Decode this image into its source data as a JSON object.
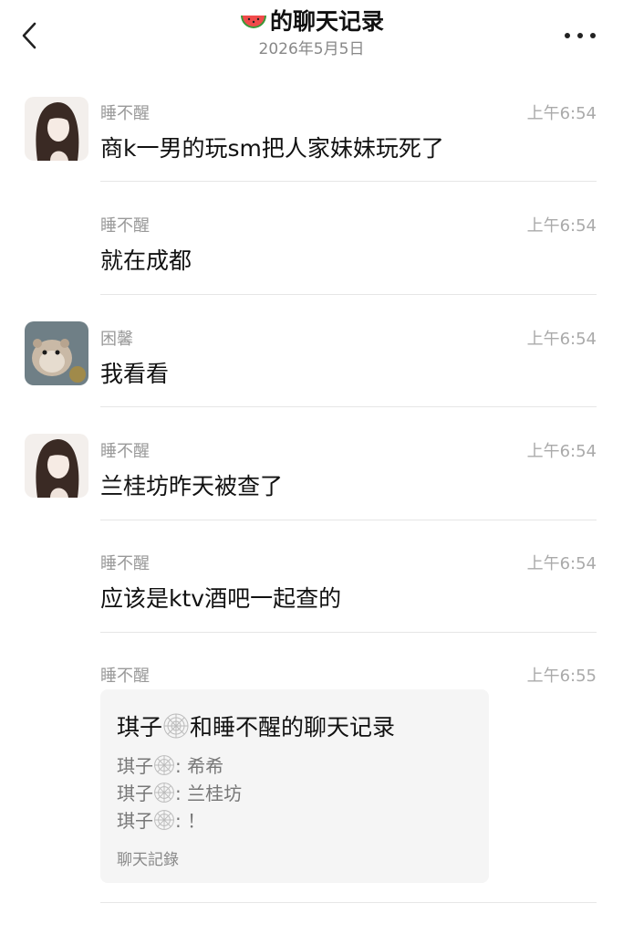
{
  "header": {
    "title_icon": "watermelon-emoji",
    "title": "的聊天记录",
    "date": "2026年5月5日",
    "back_icon": "chevron-left-icon",
    "more_icon": "more-dots-icon"
  },
  "messages": [
    {
      "sender": "睡不醒",
      "time": "上午6:54",
      "text": "商k一男的玩sm把人家妹妹玩死了",
      "avatar": "girl-avatar"
    },
    {
      "sender": "睡不醒",
      "time": "上午6:54",
      "text": "就在成都"
    },
    {
      "sender": "困馨",
      "time": "上午6:54",
      "text": "我看看",
      "avatar": "hamster-avatar"
    },
    {
      "sender": "睡不醒",
      "time": "上午6:54",
      "text": "兰桂坊昨天被查了",
      "avatar": "girl-avatar"
    },
    {
      "sender": "睡不醒",
      "time": "上午6:54",
      "text": "应该是ktv酒吧一起查的"
    },
    {
      "sender": "睡不醒",
      "time": "上午6:55"
    }
  ],
  "card": {
    "title_a": "琪子",
    "title_icon": "spider-web-emoji",
    "title_b": "和睡不醒的聊天记录",
    "lines": [
      {
        "name": "琪子",
        "text": ": 希希"
      },
      {
        "name": "琪子",
        "text": ": 兰桂坊"
      },
      {
        "name": "琪子",
        "text": ": ！"
      }
    ],
    "footer": "聊天記錄"
  },
  "colors": {
    "secondary_text": "#999999",
    "divider": "#e6e6e6",
    "card_bg": "#f5f5f5"
  }
}
